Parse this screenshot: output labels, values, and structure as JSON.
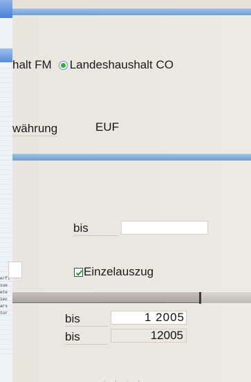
{
  "header": {
    "bands": [
      "band-top",
      "band-middle"
    ]
  },
  "budget_type": {
    "option_fm_label": "halt FM",
    "option_co_label": "Landeshaushalt CO",
    "selected": "co"
  },
  "currency": {
    "label": "währung",
    "value": "EUF"
  },
  "range_1": {
    "to_label": "bis",
    "to_value": ""
  },
  "single_statement": {
    "label": "Einzelauszug",
    "checked": true
  },
  "left_panel": {
    "tiny_lines": [
      "erfl",
      "sue",
      "ete",
      "iec",
      "ars",
      "tor"
    ]
  },
  "period_rows": [
    {
      "to_label": "bis",
      "to_value": "1 2005"
    },
    {
      "to_label": "bis",
      "to_value": "12005"
    }
  ],
  "footer": {
    "dots": ". . . ."
  }
}
